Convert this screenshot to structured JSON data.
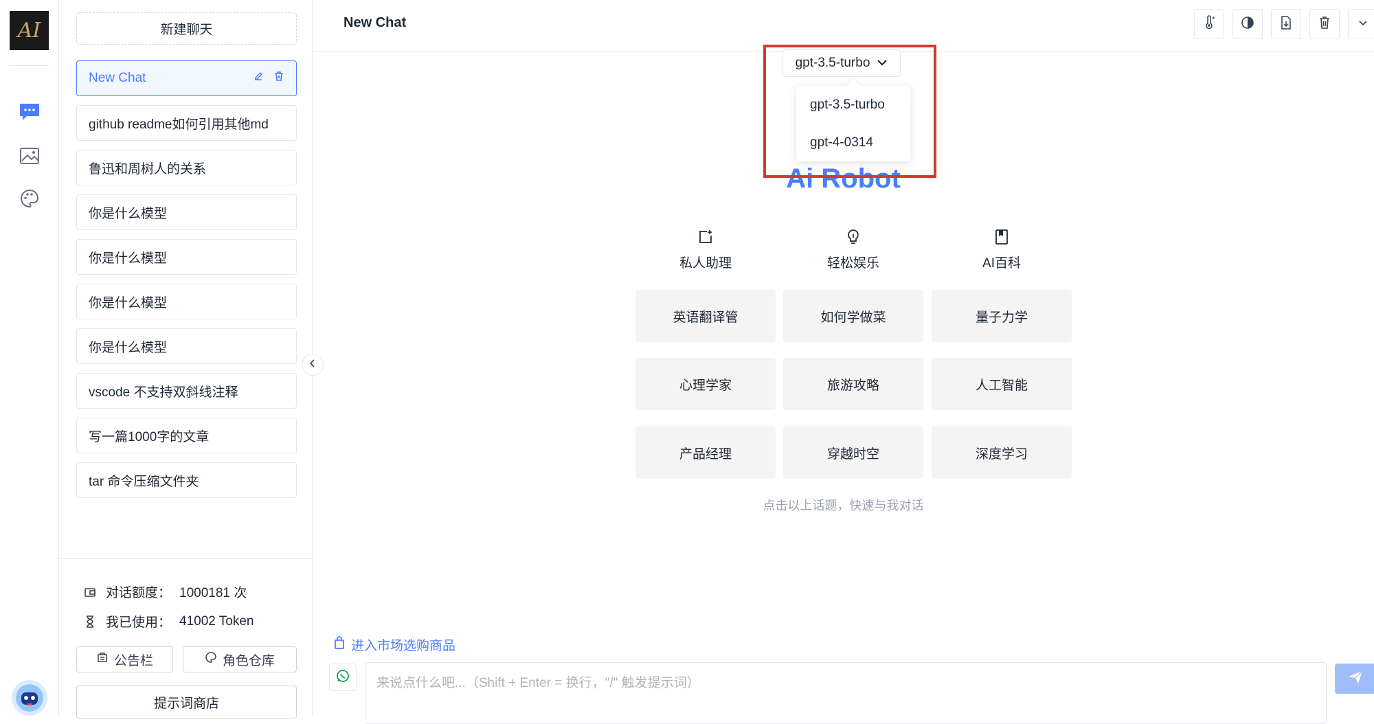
{
  "rail": {
    "logo_text": "AI",
    "icons": [
      "chat-icon",
      "image-icon",
      "palette-icon"
    ],
    "accent": "#4a7dff"
  },
  "sidebar": {
    "new_chat_label": "新建聊天",
    "chats": [
      {
        "label": "New Chat",
        "active": true
      },
      {
        "label": "github readme如何引用其他md",
        "active": false
      },
      {
        "label": "鲁迅和周树人的关系",
        "active": false
      },
      {
        "label": "你是什么模型",
        "active": false
      },
      {
        "label": "你是什么模型",
        "active": false
      },
      {
        "label": "你是什么模型",
        "active": false
      },
      {
        "label": "你是什么模型",
        "active": false
      },
      {
        "label": "vscode 不支持双斜线注释",
        "active": false
      },
      {
        "label": "写一篇1000字的文章",
        "active": false
      },
      {
        "label": "tar 命令压缩文件夹",
        "active": false
      }
    ],
    "quota_label": "对话额度：",
    "quota_value": "1000181 次",
    "used_label": "我已使用：",
    "used_value": "41002 Token",
    "announce_label": "公告栏",
    "roles_label": "角色仓库",
    "prompt_store_label": "提示词商店"
  },
  "header": {
    "title": "New Chat",
    "buttons": [
      "temperature-icon",
      "contrast-icon",
      "export-icon",
      "trash-icon",
      "chevron-down-icon"
    ]
  },
  "model": {
    "selected": "gpt-3.5-turbo",
    "options": [
      "gpt-3.5-turbo",
      "gpt-4-0314"
    ],
    "highlight_color": "#d63a2f"
  },
  "welcome": {
    "brand": "Ai Robot",
    "categories": [
      {
        "label": "私人助理",
        "icon": "assistant-icon"
      },
      {
        "label": "轻松娱乐",
        "icon": "lightbulb-icon"
      },
      {
        "label": "AI百科",
        "icon": "book-icon"
      }
    ],
    "topics": [
      "英语翻译管",
      "如何学做菜",
      "量子力学",
      "心理学家",
      "旅游攻略",
      "人工智能",
      "产品经理",
      "穿越时空",
      "深度学习"
    ],
    "hint": "点击以上话题，快速与我对话"
  },
  "composer": {
    "market_link": "进入市场选购商品",
    "placeholder": "来说点什么吧...（Shift + Enter = 换行，\"/\" 触发提示词）",
    "value": ""
  }
}
